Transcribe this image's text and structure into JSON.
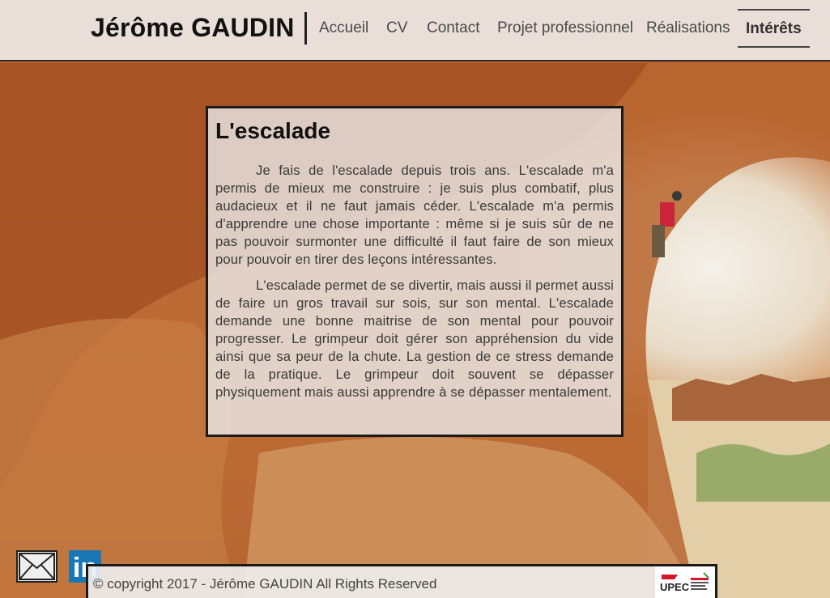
{
  "site": {
    "title": "Jérôme GAUDIN"
  },
  "nav": {
    "items": [
      {
        "label": "Accueil"
      },
      {
        "label": "CV"
      },
      {
        "label": "Contact"
      },
      {
        "label": "Projet professionnel"
      },
      {
        "label": "Réalisations"
      },
      {
        "label": "Intérêts",
        "active": true
      }
    ]
  },
  "article": {
    "heading": "L'escalade",
    "paragraphs": [
      "Je fais de l'escalade depuis trois ans. L'escalade m'a permis de mieux me construire : je suis plus combatif, plus audacieux et il ne faut jamais céder. L'escalade m'a permis d'apprendre une chose importante : même si je suis sûr de ne pas pouvoir surmonter une difficulté il faut faire de son mieux pour pouvoir en tirer des leçons intéressantes.",
      "L'escalade permet de se divertir, mais aussi il permet aussi de faire un gros travail sur sois, sur son mental. L'escalade demande une bonne maitrise de son mental pour pouvoir progresser. Le grimpeur doit gérer son appréhension du vide ainsi que sa peur de la chute. La gestion de ce stress demande de la pratique. Le grimpeur doit souvent se dépasser physiquement mais aussi apprendre à se dépasser mentalement."
    ]
  },
  "footer": {
    "copyright": "© copyright 2017 - Jérôme GAUDIN All Rights Reserved",
    "logo_text": "UPEC"
  },
  "social": {
    "mail_icon": "mail-icon",
    "linkedin_icon": "linkedin-icon",
    "linkedin_text": "in"
  },
  "colors": {
    "linkedin": "#1a77b5",
    "upec_red": "#d4162b",
    "background_rock": "#c8773f"
  }
}
